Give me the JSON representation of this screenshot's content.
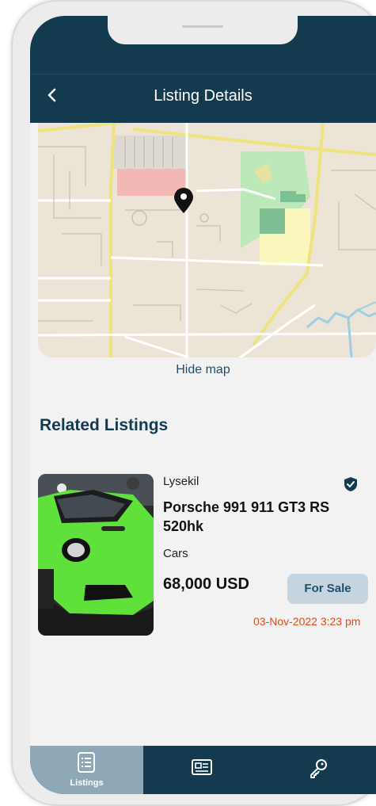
{
  "header": {
    "title": "Listing Details",
    "back_icon": "chevron-left-icon"
  },
  "map": {
    "hide_label": "Hide map",
    "pin_icon": "map-pin-icon"
  },
  "related": {
    "title": "Related Listings",
    "items": [
      {
        "location": "Lysekil",
        "title_line1": "Porsche 991 911 GT3 RS",
        "title_line2": "520hk",
        "category": "Cars",
        "price": "68,000 USD",
        "status": "For Sale",
        "date": "03-Nov-2022 3:23 pm",
        "verified_icon": "verified-shield-icon"
      }
    ]
  },
  "tabs": [
    {
      "label": "Listings",
      "icon": "list-icon",
      "active": true
    },
    {
      "label": "",
      "icon": "newspaper-icon",
      "active": false
    },
    {
      "label": "",
      "icon": "key-icon",
      "active": false
    }
  ],
  "colors": {
    "primary": "#143a4f",
    "accent_link": "#1f4f6e",
    "date": "#e24b1f",
    "badge_bg": "#c6d4e0",
    "active_tab": "#8fa8b7"
  }
}
